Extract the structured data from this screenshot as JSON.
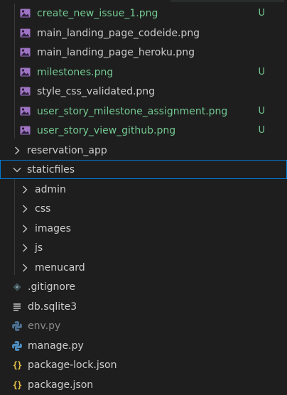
{
  "explorer": {
    "files_top": [
      {
        "name": "create_new_issue_1.png",
        "status": "U",
        "untracked": true,
        "icon": "image-icon"
      },
      {
        "name": "main_landing_page_codeide.png",
        "status": "",
        "untracked": false,
        "icon": "image-icon"
      },
      {
        "name": "main_landing_page_heroku.png",
        "status": "",
        "untracked": false,
        "icon": "image-icon"
      },
      {
        "name": "milestones.png",
        "status": "U",
        "untracked": true,
        "icon": "image-icon"
      },
      {
        "name": "style_css_validated.png",
        "status": "",
        "untracked": false,
        "icon": "image-icon"
      },
      {
        "name": "user_story_milestone_assignment.png",
        "status": "U",
        "untracked": true,
        "icon": "image-icon"
      },
      {
        "name": "user_story_view_github.png",
        "status": "U",
        "untracked": true,
        "icon": "image-icon"
      }
    ],
    "folders": {
      "reservation_app": "reservation_app",
      "staticfiles": "staticfiles",
      "admin": "admin",
      "css": "css",
      "images": "images",
      "js": "js",
      "menucard": "menucard"
    },
    "root_files": {
      "gitignore": ".gitignore",
      "db": "db.sqlite3",
      "env": "env.py",
      "manage": "manage.py",
      "package_lock": "package-lock.json",
      "package": "package.json"
    },
    "colors": {
      "untracked": "#73c991",
      "selection_border": "#0078d4",
      "python_blue": "#4b8bbe",
      "python_yellow": "#ffd43b",
      "json_yellow": "#e8c34a",
      "image_purple": "#a074c4"
    }
  }
}
